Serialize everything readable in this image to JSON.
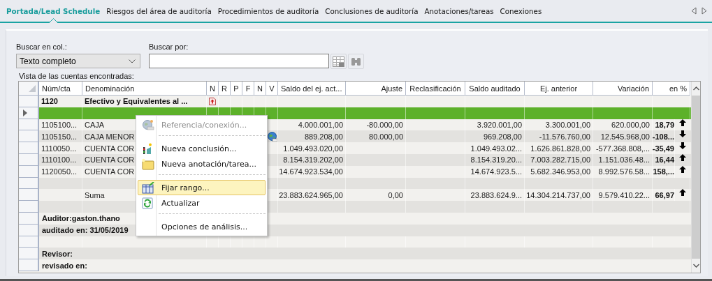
{
  "tabs": [
    {
      "label": "Portada/Lead Schedule",
      "selected": true
    },
    {
      "label": "Riesgos del área de auditoría",
      "selected": false
    },
    {
      "label": "Procedimientos de auditoría",
      "selected": false
    },
    {
      "label": "Conclusiones de auditoría",
      "selected": false
    },
    {
      "label": "Anotaciones/tareas",
      "selected": false
    },
    {
      "label": "Conexiones",
      "selected": false
    }
  ],
  "search": {
    "column_label": "Buscar en col.:",
    "column_value": "Texto completo",
    "query_label": "Buscar por:"
  },
  "grid": {
    "caption": "Vista de las cuentas encontradas:",
    "columns": [
      "Núm/cta",
      "Denominación",
      "N",
      "R",
      "P",
      "F",
      "N",
      "V",
      "Saldo del ej. act...",
      "Ajuste",
      "Reclasificación",
      "Saldo auditado",
      "Ej. anterior",
      "Variación",
      "en %"
    ],
    "rows": [
      {
        "kind": "group",
        "selected": false,
        "num": "1120",
        "name": "Efectivo y Equivalentes al ...",
        "document": true
      },
      {
        "kind": "blank",
        "selected": true
      },
      {
        "kind": "account",
        "selected": false,
        "num": "1105100...",
        "name": "CAJA",
        "link": false,
        "saldo": "4.000.001,00",
        "ajuste": "-80.000,00",
        "auditado": "3.920.001,00",
        "anterior": "3.300.001,00",
        "variacion": "620.000,00",
        "percent": "18,79",
        "rising": true
      },
      {
        "kind": "account",
        "selected": false,
        "num": "1105150...",
        "name": "CAJA MENOR",
        "link": true,
        "saldo": "889.208,00",
        "ajuste": "80.000,00",
        "auditado": "969.208,00",
        "anterior": "-11.576.760,00",
        "variacion": "12.545.968,00",
        "percent": "-108...",
        "rising": false
      },
      {
        "kind": "account",
        "selected": false,
        "num": "1110050...",
        "name": "CUENTA COR",
        "link": false,
        "saldo": "1.049.493.020,00",
        "auditado": "1.049.493.02...",
        "anterior": "1.626.861.828,00",
        "variacion": "-577.368.808,...",
        "percent": "-35,49",
        "rising": false
      },
      {
        "kind": "account",
        "selected": false,
        "num": "1110100...",
        "name": "CUENTA COR",
        "link": false,
        "saldo": "8.154.319.202,00",
        "auditado": "8.154.319.20...",
        "anterior": "7.003.282.715,00",
        "variacion": "1.151.036.48...",
        "percent": "16,44",
        "rising": true
      },
      {
        "kind": "account",
        "selected": false,
        "num": "1120050...",
        "name": "CUENTA COR",
        "link": false,
        "saldo": "14.674.923.534,00",
        "auditado": "14.674.923.5...",
        "anterior": "5.682.346.953,00",
        "variacion": "8.992.576.58...",
        "percent": "158,...",
        "rising": true
      },
      {
        "kind": "blank",
        "selected": false
      },
      {
        "kind": "account",
        "selected": false,
        "name": "Suma",
        "link": false,
        "saldo": "23.883.624.965,00",
        "ajuste": "0,00",
        "auditado": "23.883.624.9...",
        "anterior": "14.304.214.737,00",
        "variacion": "9.579.410.22...",
        "percent": "66,97",
        "rising": true
      },
      {
        "kind": "blank",
        "selected": false
      },
      {
        "kind": "note",
        "selected": false,
        "text": "Auditor:gaston.thano"
      },
      {
        "kind": "note",
        "selected": false,
        "text": "auditado en: 31/05/2019"
      },
      {
        "kind": "blank",
        "selected": false
      },
      {
        "kind": "note",
        "selected": false,
        "text": "Revisor:"
      },
      {
        "kind": "note",
        "selected": false,
        "text": "revisado en:"
      }
    ]
  },
  "context_menu": [
    {
      "kind": "item",
      "label": "Referencia/conexión...",
      "disabled": true,
      "selected": false
    },
    {
      "kind": "separator"
    },
    {
      "kind": "item",
      "label": "Nueva conclusión...",
      "disabled": false,
      "selected": false
    },
    {
      "kind": "item",
      "label": "Nueva anotación/tarea...",
      "disabled": false,
      "selected": false
    },
    {
      "kind": "separator"
    },
    {
      "kind": "item",
      "label": "Fijar rango...",
      "disabled": false,
      "selected": true
    },
    {
      "kind": "item",
      "label": "Actualizar",
      "disabled": false,
      "selected": false
    },
    {
      "kind": "separator"
    },
    {
      "kind": "item",
      "label": "Opciones de análisis...",
      "disabled": false,
      "selected": false
    }
  ]
}
